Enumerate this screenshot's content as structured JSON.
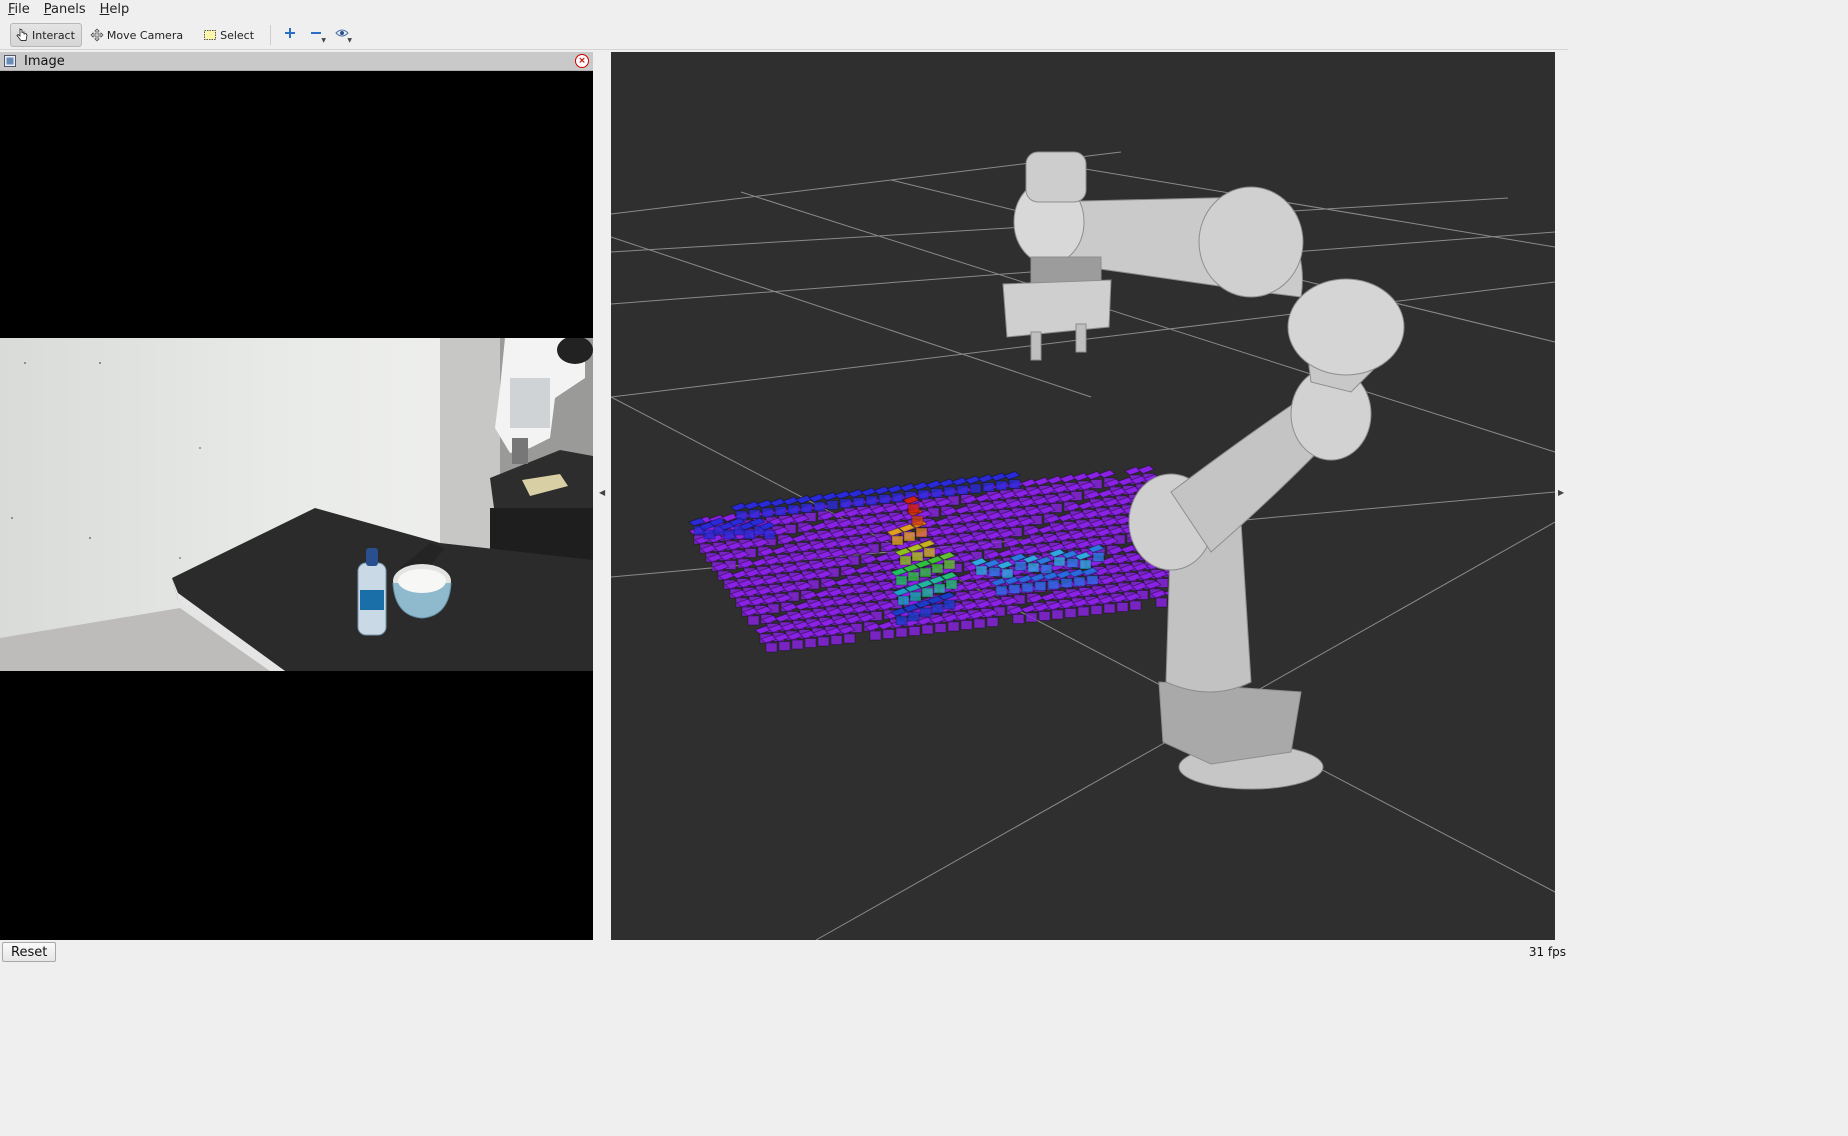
{
  "menubar": {
    "items": [
      {
        "label": "File",
        "mnemonic": "F",
        "rest": "ile"
      },
      {
        "label": "Panels",
        "mnemonic": "P",
        "rest": "anels"
      },
      {
        "label": "Help",
        "mnemonic": "H",
        "rest": "elp"
      }
    ]
  },
  "toolbar": {
    "interact_label": "Interact",
    "move_camera_label": "Move Camera",
    "select_label": "Select",
    "active_tool": "Interact",
    "icons": [
      "hand-pointer-icon",
      "move-camera-icon",
      "select-rectangle-icon",
      "add-tool-icon",
      "remove-tool-icon",
      "eye-view-icon"
    ]
  },
  "image_panel": {
    "title": "Image"
  },
  "status": {
    "reset_label": "Reset",
    "fps_text": "31 fps"
  },
  "colors": {
    "viewport_background": "#2f2f2f",
    "grid_line": "#8a8a8a",
    "window_background": "#efefef"
  }
}
